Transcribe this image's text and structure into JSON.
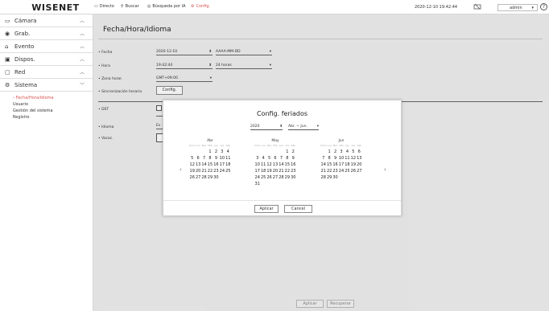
{
  "topbar": {
    "logo": "WISENET",
    "live": "Directo",
    "search": "Buscar",
    "ai_search": "Búsqueda por IA",
    "config": "Config.",
    "datetime": "2020-12-10 19:42:44",
    "user": "admin",
    "help": "?"
  },
  "sidebar": {
    "items": [
      {
        "label": "Cámara",
        "icon": "camera-icon"
      },
      {
        "label": "Grab.",
        "icon": "record-icon"
      },
      {
        "label": "Evento",
        "icon": "event-icon"
      },
      {
        "label": "Dispos.",
        "icon": "device-icon"
      },
      {
        "label": "Red",
        "icon": "network-icon"
      },
      {
        "label": "Sistema",
        "icon": "system-icon"
      }
    ],
    "sub": [
      "Fecha/Hora/Idioma",
      "Usuario",
      "Gestión del sistema",
      "Registro"
    ]
  },
  "main": {
    "title": "Fecha/Hora/Idioma",
    "date_label": "Fecha",
    "date_value": "2020-12-10",
    "date_format": "AAAA-MM-DD",
    "time_label": "Hora",
    "time_value": "19:42:44",
    "time_format": "24 horas",
    "tz_label": "Zona horar.",
    "tz_value": "GMT+09:00",
    "sync_label": "Sincronización horaria",
    "sync_btn": "Config.",
    "dst_label": "DST",
    "lang_label": "Idioma",
    "lang_value": "Es",
    "holiday_label": "Vacac.",
    "apply": "Aplicar",
    "restore": "Recuperar"
  },
  "dialog": {
    "title": "Config. feriados",
    "year": "2020",
    "range": "Abr. ~ Jun.",
    "weekdays": [
      "Dom",
      "Lun",
      "Mar",
      "Mié",
      "Jue",
      "Vie",
      "Sáb"
    ],
    "months": [
      {
        "name": "Abr",
        "days": [
          "",
          "",
          "",
          "1",
          "2",
          "3",
          "4",
          "5",
          "6",
          "7",
          "8",
          "9",
          "10",
          "11",
          "12",
          "13",
          "14",
          "15",
          "16",
          "17",
          "18",
          "19",
          "20",
          "21",
          "22",
          "23",
          "24",
          "25",
          "26",
          "27",
          "28",
          "29",
          "30"
        ]
      },
      {
        "name": "May",
        "days": [
          "",
          "",
          "",
          "",
          "",
          "1",
          "2",
          "3",
          "4",
          "5",
          "6",
          "7",
          "8",
          "9",
          "10",
          "11",
          "12",
          "13",
          "14",
          "15",
          "16",
          "17",
          "18",
          "19",
          "20",
          "21",
          "22",
          "23",
          "24",
          "25",
          "26",
          "27",
          "28",
          "29",
          "30",
          "31"
        ]
      },
      {
        "name": "Jun",
        "days": [
          "",
          "1",
          "2",
          "3",
          "4",
          "5",
          "6",
          "7",
          "8",
          "9",
          "10",
          "11",
          "12",
          "13",
          "14",
          "15",
          "16",
          "17",
          "18",
          "19",
          "20",
          "21",
          "22",
          "23",
          "24",
          "25",
          "26",
          "27",
          "28",
          "29",
          "30"
        ]
      }
    ],
    "prev": "‹",
    "next": "›",
    "apply": "Aplicar",
    "cancel": "Cancel"
  }
}
